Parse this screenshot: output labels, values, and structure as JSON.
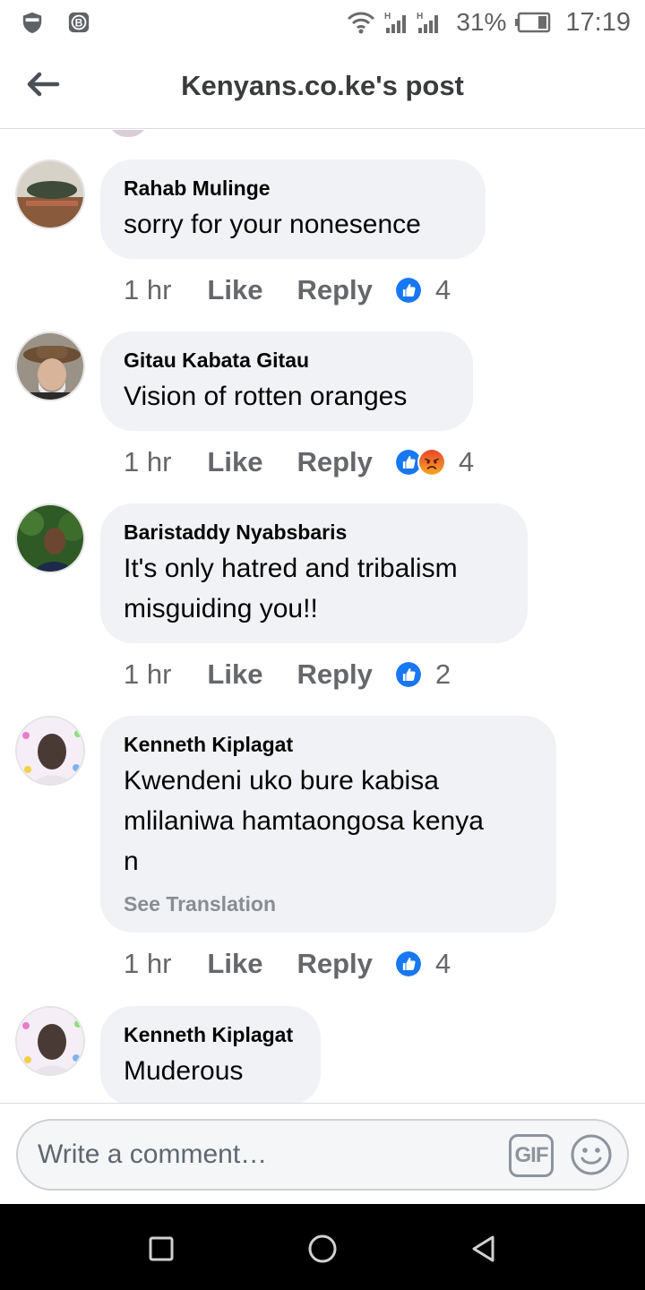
{
  "status_bar": {
    "battery_percent": "31%",
    "time": "17:19",
    "icons": [
      "shield-icon",
      "b-badge-icon",
      "wifi-icon",
      "signal-icon",
      "battery-icon"
    ]
  },
  "header": {
    "title": "Kenyans.co.ke's post",
    "back_icon": "arrow-left-icon"
  },
  "comments": [
    {
      "author": "Rahab Mulinge",
      "text": "sorry for your nonesence",
      "time": "1 hr",
      "like_label": "Like",
      "reply_label": "Reply",
      "reactions": [
        "like"
      ],
      "reaction_count": "4"
    },
    {
      "author": "Gitau Kabata Gitau",
      "text": "Vision of rotten oranges",
      "time": "1 hr",
      "like_label": "Like",
      "reply_label": "Reply",
      "reactions": [
        "like",
        "angry"
      ],
      "reaction_count": "4"
    },
    {
      "author": "Baristaddy Nyabsbaris",
      "text_line1": "It's only hatred and tribalism",
      "text_line2": "misguiding you!!",
      "time": "1 hr",
      "like_label": "Like",
      "reply_label": "Reply",
      "reactions": [
        "like"
      ],
      "reaction_count": "2"
    },
    {
      "author": "Kenneth Kiplagat",
      "text_line1": "Kwendeni uko bure kabisa",
      "text_line2": "mlilaniwa hamtaongosa kenya",
      "text_line3": "n",
      "translate": "See Translation",
      "time": "1 hr",
      "like_label": "Like",
      "reply_label": "Reply",
      "reactions": [
        "like"
      ],
      "reaction_count": "4"
    },
    {
      "author": "Kenneth Kiplagat",
      "text": "Muderous"
    }
  ],
  "composer": {
    "placeholder": "Write a comment…",
    "gif_label": "GIF",
    "emoji_icon": "smiley-icon"
  },
  "nav_bar": {
    "icons": [
      "recents-square-icon",
      "home-circle-icon",
      "back-triangle-icon"
    ]
  },
  "colors": {
    "like_blue": "#1877f2",
    "angry_orange": "#f0772a",
    "bubble_gray": "#f0f2f5",
    "meta_gray": "#65676b"
  }
}
